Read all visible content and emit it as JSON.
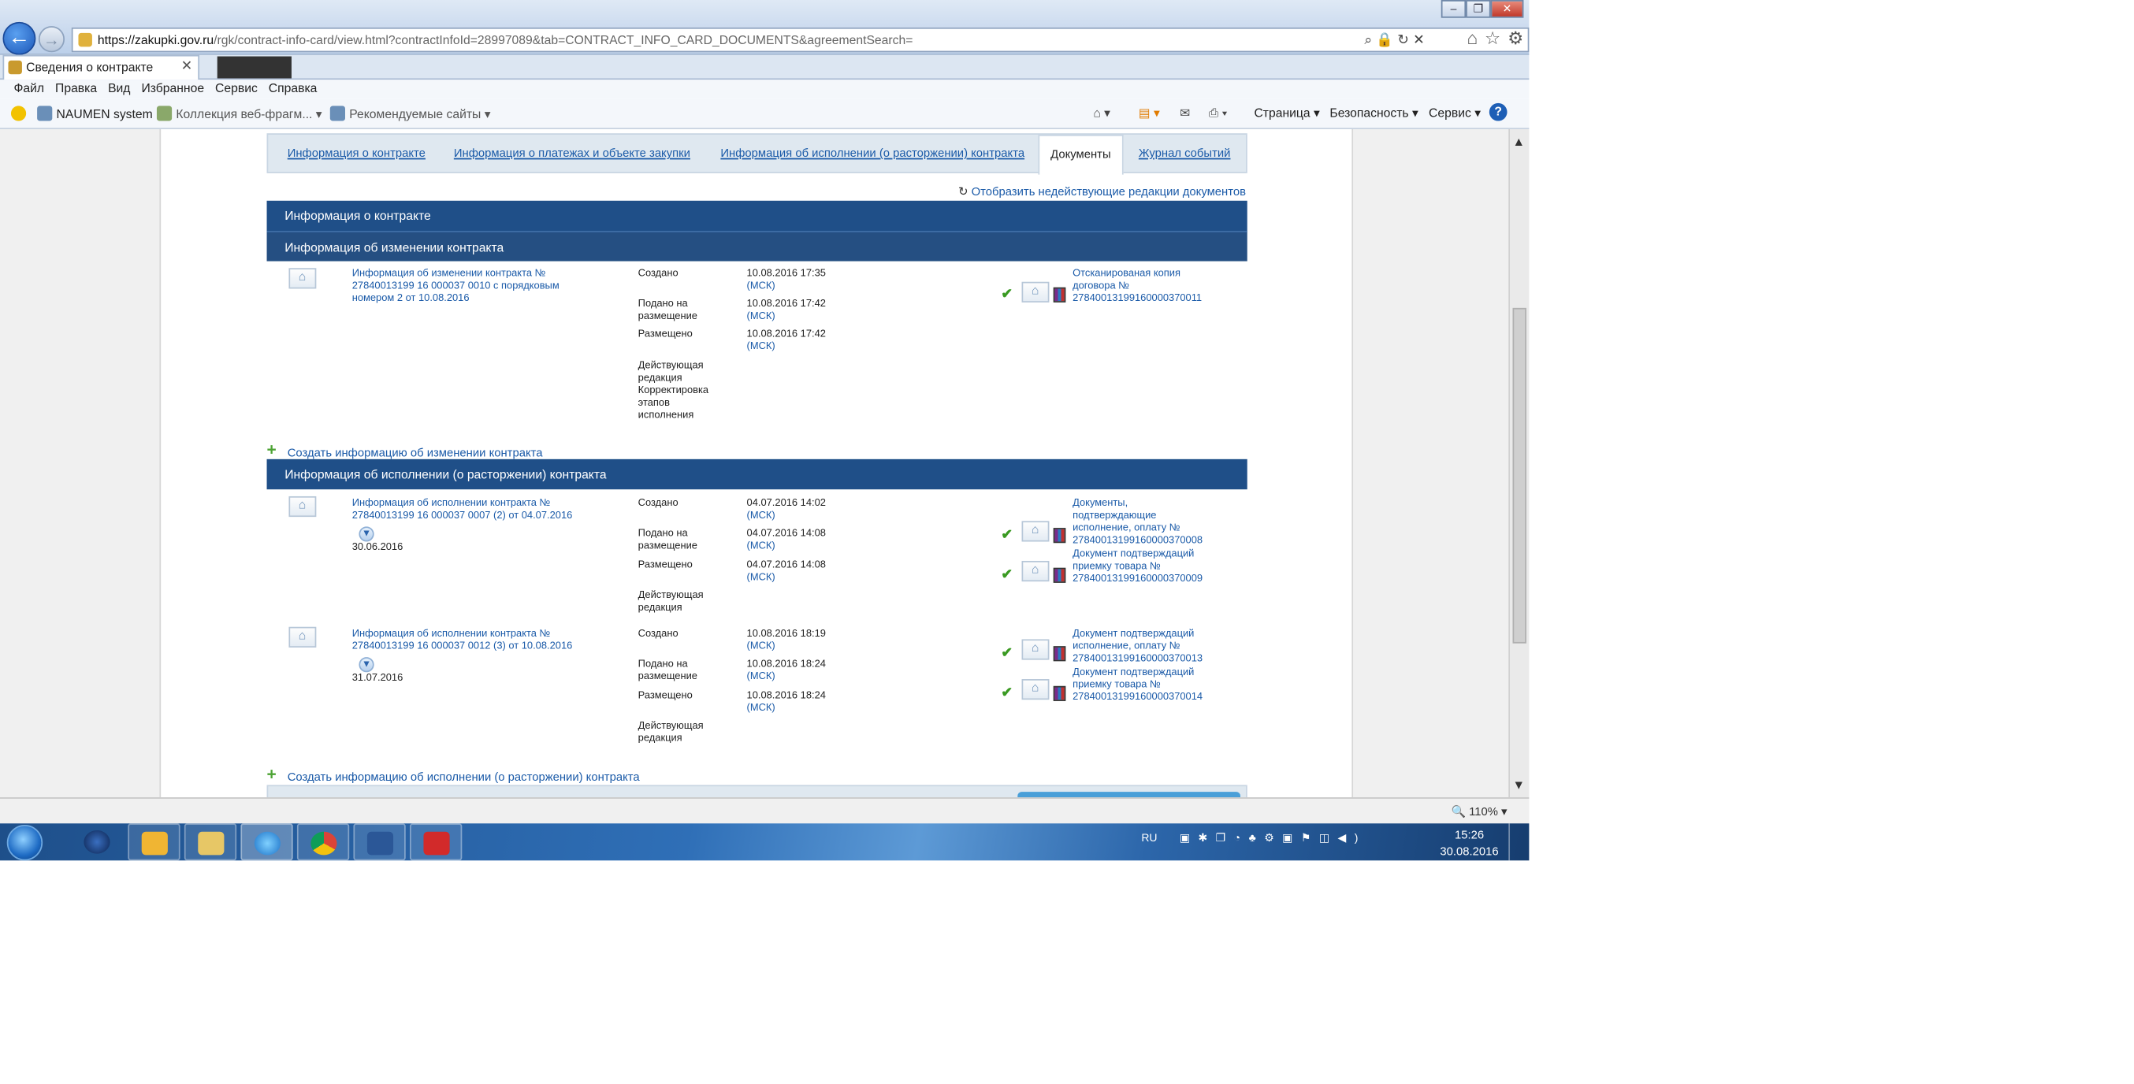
{
  "browser": {
    "url_host": "https://zakupki.gov.ru",
    "url_path": "/rgk/contract-info-card/view.html?contractInfoId=28997089&tab=CONTRACT_INFO_CARD_DOCUMENTS&agreementSearch=",
    "tab_title": "Сведения о контракте",
    "menu": [
      "Файл",
      "Правка",
      "Вид",
      "Избранное",
      "Сервис",
      "Справка"
    ],
    "favorites": {
      "item1": "NAUMEN system",
      "item2": "Коллекция веб-фрагм...",
      "item3": "Рекомендуемые сайты"
    },
    "cmd": {
      "page": "Страница",
      "security": "Безопасность",
      "service": "Сервис"
    },
    "zoom": "110%"
  },
  "tabs": {
    "info": "Информация о контракте",
    "payments": "Информация о платежах и объекте закупки",
    "execution": "Информация об исполнении (о расторжении) контракта",
    "documents": "Документы",
    "journal": "Журнал событий"
  },
  "show_old": "Отобразить недействующие редакции документов",
  "sections": {
    "contract_info": "Информация о контракте",
    "change_info": "Информация об изменении контракта",
    "exec_info": "Информация об исполнении (о расторжении) контракта"
  },
  "labels": {
    "created": "Создано",
    "submitted_1": "Подано на",
    "submitted_2": "размещение",
    "placed": "Размещено",
    "current_1": "Действующая",
    "current_2": "редакция",
    "corr_1": "Корректировка",
    "corr_2": "этапов",
    "corr_3": "исполнения",
    "msk": "(МСК)"
  },
  "change": {
    "title_1": "Информация об изменении контракта №",
    "title_2": "27840013199 16 000037 0010 с порядковым",
    "title_3": "номером 2 от 10.08.2016",
    "created": "10.08.2016 17:35",
    "submitted": "10.08.2016 17:42",
    "placed": "10.08.2016 17:42",
    "file_1": "Отсканированая копия",
    "file_2": "договора №",
    "file_3": "2784001319916000037001​1"
  },
  "create_change": "Создать информацию об изменении контракта",
  "exec1": {
    "title_1": "Информация об исполнении контракта №",
    "title_2": "27840013199 16 000037 0007 (2) от 04.07.2016",
    "date": "30.06.2016",
    "created": "04.07.2016 14:02",
    "submitted": "04.07.2016 14:08",
    "placed": "04.07.2016 14:08",
    "f1_1": "Документы,",
    "f1_2": "подтверждающие",
    "f1_3": "исполнение, оплату №",
    "f1_4": "2784001319916000037000​8",
    "f2_1": "Документ подтверждаций",
    "f2_2": "приемку товара №",
    "f2_3": "2784001319916000037000​9"
  },
  "exec2": {
    "title_1": "Информация об исполнении контракта №",
    "title_2": "27840013199 16 000037 0012 (3) от 10.08.2016",
    "date": "31.07.2016",
    "created": "10.08.2016 18:19",
    "submitted": "10.08.2016 18:24",
    "placed": "10.08.2016 18:24",
    "f1_1": "Документ подтверждаций",
    "f1_2": "исполнение, оплату №",
    "f1_3": "2784001319916000037001​3",
    "f2_1": "Документ подтверждаций",
    "f2_2": "приемку товара №",
    "f2_3": "2784001319916000037001​4"
  },
  "create_exec": "Создать информацию об исполнении (о расторжении) контракта",
  "taskbar": {
    "lang": "RU",
    "time": "15:26",
    "date": "30.08.2016"
  },
  "colors": {
    "section_header": "#1f4f88",
    "link": "#1a5aa8",
    "check": "#3a9a22"
  }
}
